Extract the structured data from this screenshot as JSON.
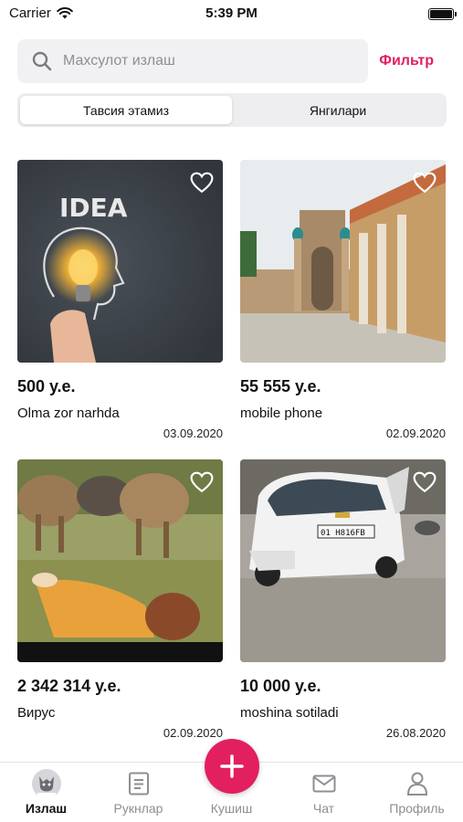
{
  "status_bar": {
    "carrier": "Carrier",
    "time": "5:39 PM"
  },
  "search": {
    "placeholder": "Махсулот излаш",
    "value": ""
  },
  "filter_label": "Фильтр",
  "tabs_segment": [
    {
      "label": "Тавсия этамиз",
      "active": true
    },
    {
      "label": "Янгилари",
      "active": false
    }
  ],
  "products": [
    {
      "price": "500 у.е.",
      "title": "Olma zor narhda",
      "date": "03.09.2020",
      "image": "idea-lightbulb-photo"
    },
    {
      "price": "55 555 у.е.",
      "title": "mobile phone",
      "date": "02.09.2020",
      "image": "mosque-courtyard-photo"
    },
    {
      "price": "2 342 314 у.е.",
      "title": "Вирус",
      "date": "02.09.2020",
      "image": "sheep-field-photo"
    },
    {
      "price": "10 000 у.е.",
      "title": "moshina sotiladi",
      "date": "26.08.2020",
      "image": "damaged-car-photo"
    }
  ],
  "photo_text": {
    "idea_word": "IDEA",
    "plate": "01 H816FB"
  },
  "tab_bar": {
    "items": [
      {
        "label": "Излаш",
        "icon": "avatar-icon",
        "active": true
      },
      {
        "label": "Рукнлар",
        "icon": "list-icon",
        "active": false
      },
      {
        "label": "Кушиш",
        "icon": "plus-icon",
        "active": false
      },
      {
        "label": "Чат",
        "icon": "mail-icon",
        "active": false
      },
      {
        "label": "Профиль",
        "icon": "user-icon",
        "active": false
      }
    ]
  },
  "colors": {
    "accent": "#e2205f",
    "muted": "#8e8e93",
    "search_bg": "#f1f1f3"
  }
}
